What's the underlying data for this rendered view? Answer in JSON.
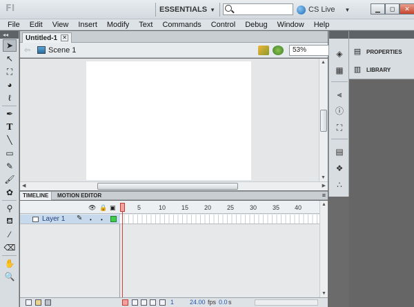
{
  "titlebar": {
    "logo": "Fl",
    "workspace": "ESSENTIALS",
    "search_placeholder": "",
    "cslive": "CS Live"
  },
  "menu": [
    "File",
    "Edit",
    "View",
    "Insert",
    "Modify",
    "Text",
    "Commands",
    "Control",
    "Debug",
    "Window",
    "Help"
  ],
  "document": {
    "tab_label": "Untitled-1",
    "scene_label": "Scene 1",
    "zoom": "53%"
  },
  "timeline": {
    "tabs": [
      "TIMELINE",
      "MOTION EDITOR"
    ],
    "layer_name": "Layer 1",
    "frame_numbers": [
      "1",
      "5",
      "10",
      "15",
      "20",
      "25",
      "30",
      "35",
      "40"
    ],
    "current_frame": "1",
    "fps": "24.00",
    "fps_label": "fps",
    "time": "0.0",
    "time_label": "s"
  },
  "panels": {
    "properties": "PROPERTIES",
    "library": "LIBRARY"
  },
  "colors": {
    "layer_color": "#3cd04a",
    "playhead": "#d53c3c",
    "accent": "#1f56a8"
  }
}
